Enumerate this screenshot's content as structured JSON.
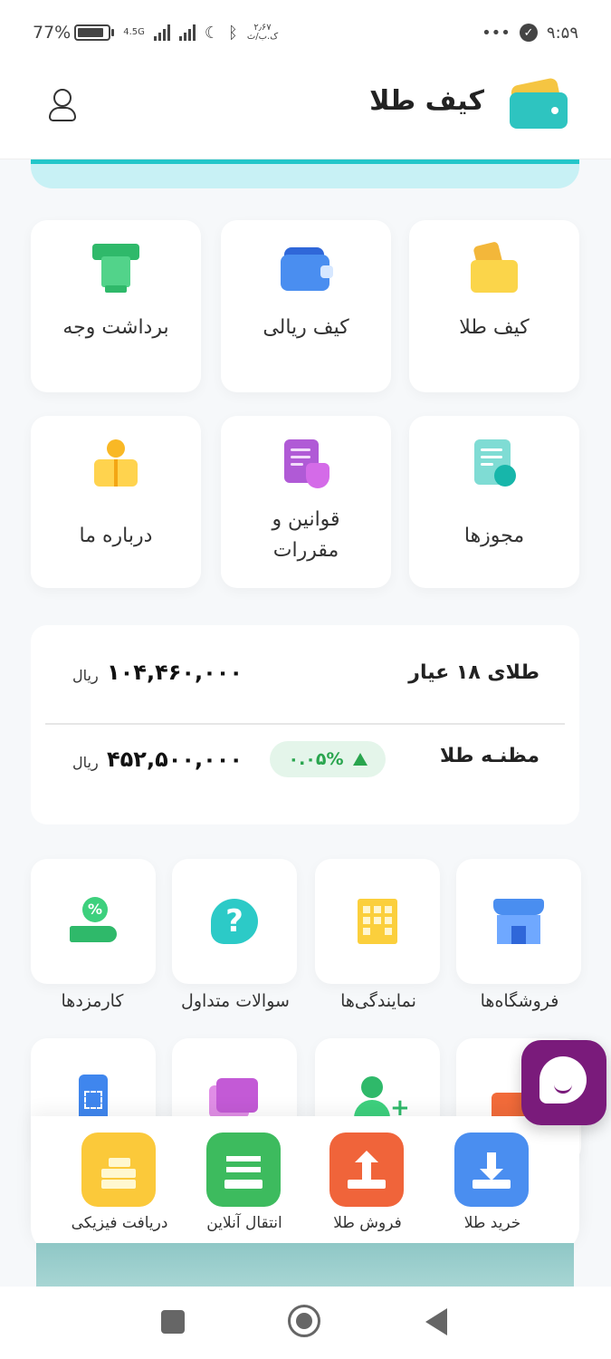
{
  "status_bar": {
    "battery": "77%",
    "network": "4.5G",
    "data_speed": "۲٫۶۷",
    "data_unit": "ک.ب/ث",
    "time": "۹:۵۹",
    "dots": "•••"
  },
  "header": {
    "title": "کیف طلا"
  },
  "grid": [
    {
      "label": "کیف طلا",
      "icon": "gold-wallet-icon"
    },
    {
      "label": "کیف ریالی",
      "icon": "rial-wallet-icon"
    },
    {
      "label": "برداشت وجه",
      "icon": "withdraw-icon"
    },
    {
      "label": "مجوزها",
      "icon": "license-icon"
    },
    {
      "label": "قوانین و مقررات",
      "icon": "rules-icon"
    },
    {
      "label": "درباره ما",
      "icon": "about-icon"
    }
  ],
  "prices": [
    {
      "name": "طلای ۱۸ عیار",
      "value": "۱۰۴,۴۶۰,۰۰۰",
      "unit": "ریال"
    },
    {
      "name": "مظنـه طلا",
      "value": "۴۵۲,۵۰۰,۰۰۰",
      "unit": "ریال",
      "change": "۰.۰۵%",
      "change_color": "#29a54e"
    }
  ],
  "services": [
    {
      "label": "فروشگاه‌ها",
      "icon": "store-icon"
    },
    {
      "label": "نمایندگی‌ها",
      "icon": "agency-icon"
    },
    {
      "label": "سوالات متداول",
      "icon": "faq-icon"
    },
    {
      "label": "کارمزدها",
      "icon": "fee-icon"
    }
  ],
  "actions": [
    {
      "label": "خرید طلا",
      "color": "#4a8ef0"
    },
    {
      "label": "فروش طلا",
      "color": "#f0643a"
    },
    {
      "label": "انتقال آنلاین",
      "color": "#3dbb5e"
    },
    {
      "label": "دریافت فیزیکی",
      "color": "#fbc93a"
    }
  ]
}
